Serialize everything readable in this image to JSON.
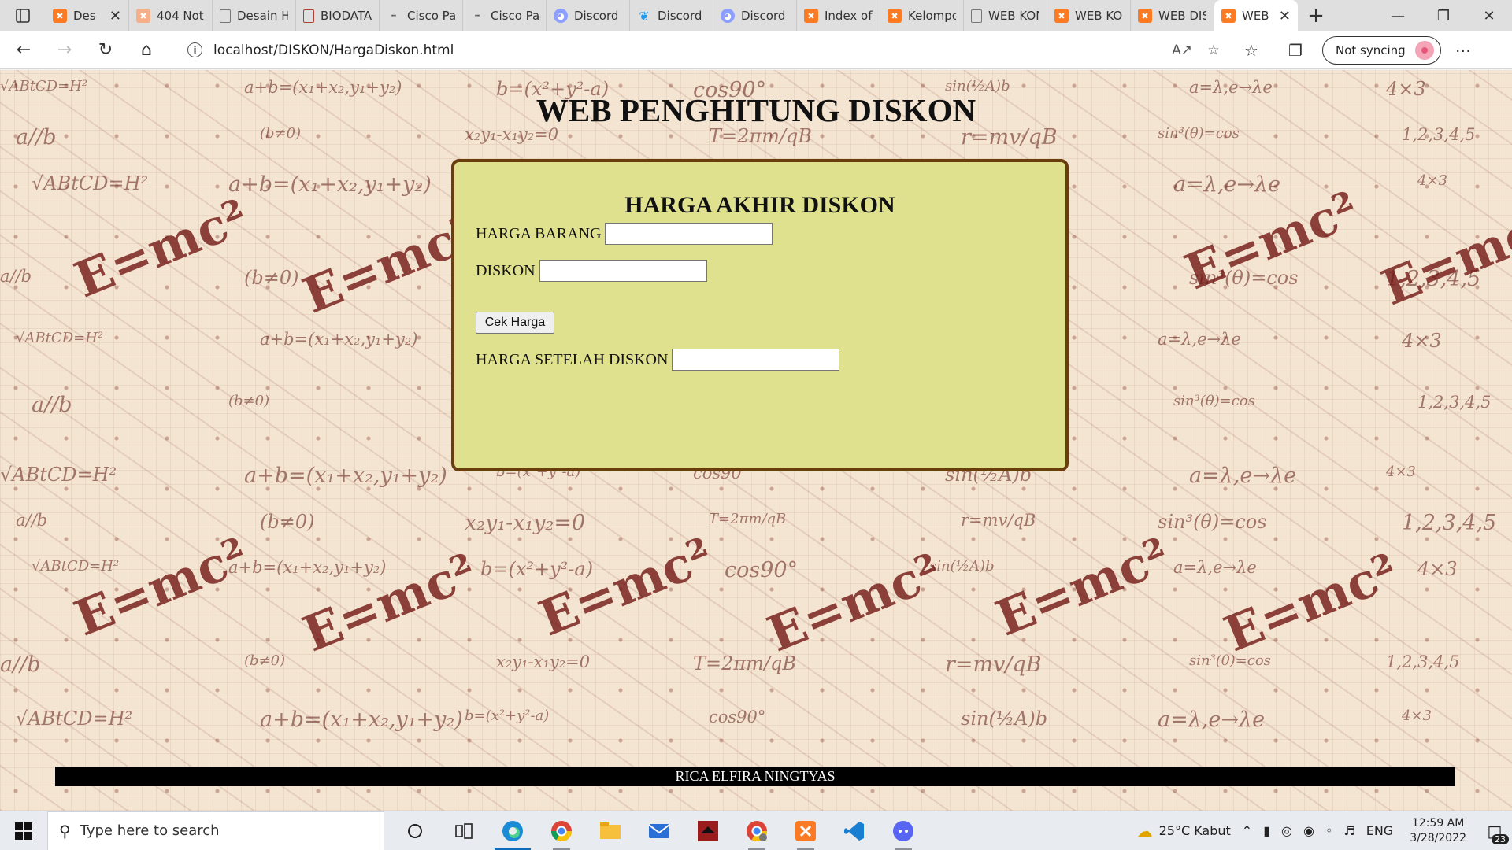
{
  "browser": {
    "tabs": [
      {
        "title": "Des",
        "favicon": "xampp-icon",
        "closable": true
      },
      {
        "title": "404 Not",
        "favicon": "xampp-icon"
      },
      {
        "title": "Desain H",
        "favicon": "page-icon"
      },
      {
        "title": "BIODATA",
        "favicon": "pdf-icon"
      },
      {
        "title": "Cisco Pac",
        "favicon": "cisco-icon"
      },
      {
        "title": "Cisco Pac",
        "favicon": "cisco-icon"
      },
      {
        "title": "Discord S",
        "favicon": "discord-icon"
      },
      {
        "title": "Discord (",
        "favicon": "twitter-icon"
      },
      {
        "title": "Discord S",
        "favicon": "discord-icon"
      },
      {
        "title": "Index of",
        "favicon": "xampp-icon"
      },
      {
        "title": "Kelompo",
        "favicon": "xampp-icon"
      },
      {
        "title": "WEB KON",
        "favicon": "page-icon"
      },
      {
        "title": "WEB KON",
        "favicon": "xampp-icon"
      },
      {
        "title": "WEB DIS",
        "favicon": "xampp-icon"
      },
      {
        "title": "WEB",
        "favicon": "xampp-icon",
        "active": true,
        "closable": true
      }
    ],
    "url": "localhost/DISKON/HargaDiskon.html",
    "sync_label": "Not syncing"
  },
  "page": {
    "title": "WEB PENGHITUNG DISKON",
    "card_heading": "HARGA AKHIR DISKON",
    "fields": {
      "harga_barang": {
        "label": "HARGA BARANG",
        "value": ""
      },
      "diskon": {
        "label": "DISKON",
        "value": ""
      },
      "harga_setelah_diskon": {
        "label": "HARGA SETELAH DISKON",
        "value": ""
      }
    },
    "button_label": "Cek Harga",
    "footer": "RICA ELFIRA NINGTYAS",
    "colors": {
      "card_background": "#dfe18e",
      "card_border": "#6a3e0c",
      "footer_background": "#000000",
      "page_background": "#f4e5d2"
    }
  },
  "taskbar": {
    "search_placeholder": "Type here to search",
    "apps": [
      "task-view-icon",
      "cortana-icon",
      "edge-icon",
      "chrome-icon",
      "file-explorer-icon",
      "mail-icon",
      "app-icon",
      "chrome-profile-icon",
      "xampp-icon",
      "vscode-icon",
      "discord-icon"
    ],
    "weather": "25°C  Kabut",
    "language": "ENG",
    "time": "12:59 AM",
    "date": "3/28/2022",
    "notification_count": "23"
  }
}
